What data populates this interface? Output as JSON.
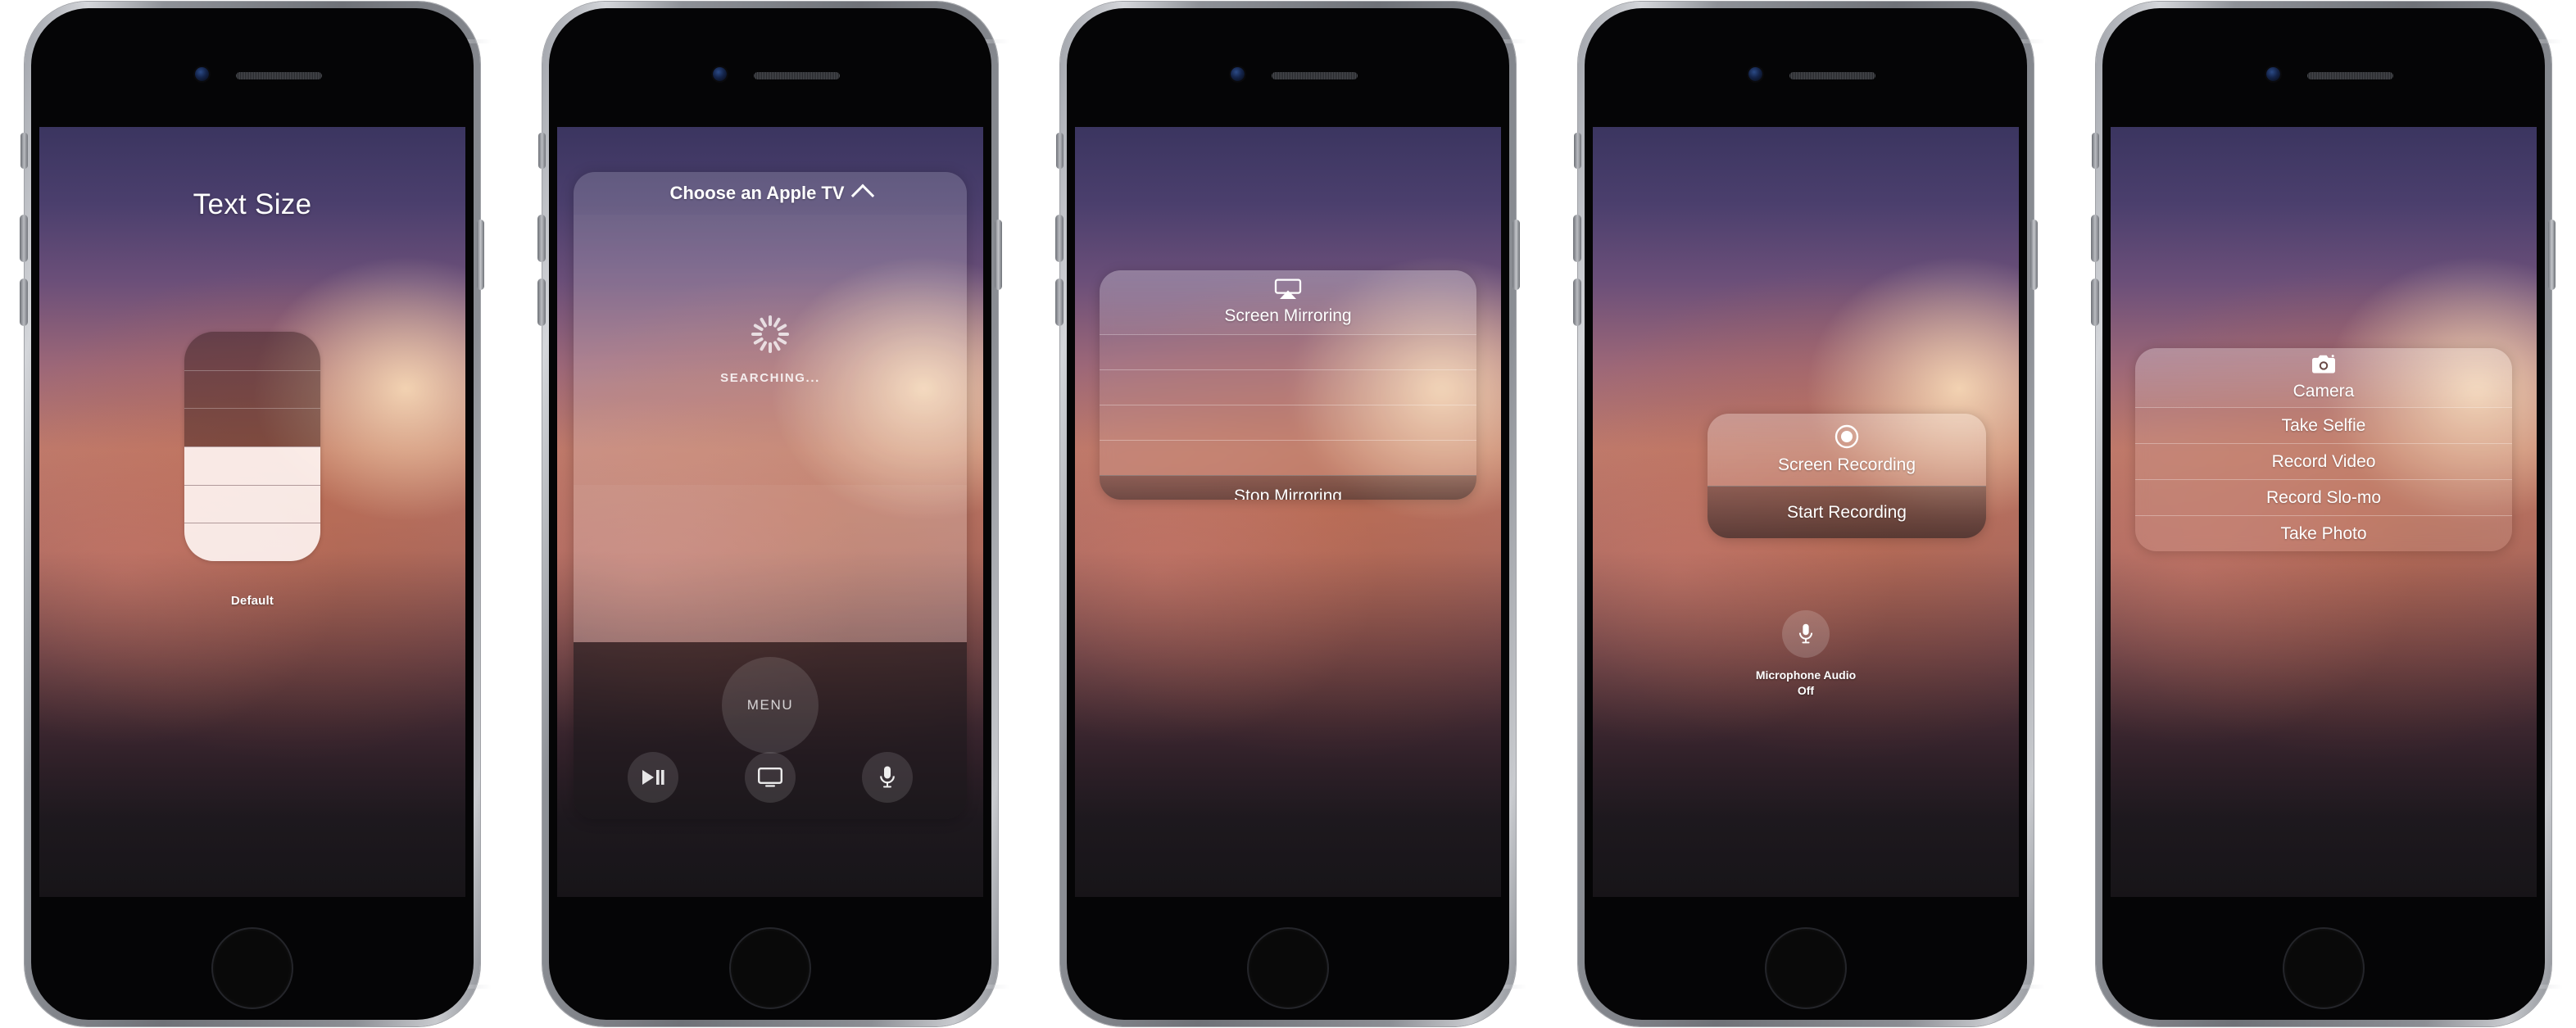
{
  "phones": [
    {
      "id": "text-size",
      "screen": {
        "title": "Text Size",
        "default_label": "Default",
        "slider": {
          "segments": 6,
          "filled_from_bottom": 3
        }
      }
    },
    {
      "id": "apple-tv-remote",
      "screen": {
        "header_title": "Choose an Apple TV",
        "header_icon": "chevron-up-icon",
        "status_text": "SEARCHING...",
        "status_icon": "spinner-icon",
        "menu_button_label": "MENU",
        "controls": [
          {
            "name": "play-pause-icon",
            "label": "Play/Pause"
          },
          {
            "name": "tv-icon",
            "label": "TV"
          },
          {
            "name": "microphone-icon",
            "label": "Siri"
          }
        ]
      }
    },
    {
      "id": "screen-mirroring",
      "screen": {
        "header_title": "Screen Mirroring",
        "header_icon": "airplay-icon",
        "empty_rows": 4,
        "footer_action": "Stop Mirroring"
      }
    },
    {
      "id": "screen-recording",
      "screen": {
        "header_title": "Screen Recording",
        "header_icon": "record-circle-icon",
        "primary_action": "Start Recording",
        "microphone": {
          "icon": "microphone-icon",
          "label": "Microphone Audio",
          "state": "Off"
        }
      }
    },
    {
      "id": "camera-menu",
      "screen": {
        "header_title": "Camera",
        "header_icon": "camera-icon",
        "items": [
          {
            "label": "Take Selfie"
          },
          {
            "label": "Record Video"
          },
          {
            "label": "Record Slo-mo"
          },
          {
            "label": "Take Photo"
          }
        ]
      }
    }
  ],
  "colors": {
    "wallpaper_top": "#3b3560",
    "wallpaper_mid": "#bd7a6c",
    "wallpaper_bottom": "#2a252c",
    "text_primary": "#ffffff",
    "device_body": "#8e9197",
    "device_glass": "#050506"
  }
}
